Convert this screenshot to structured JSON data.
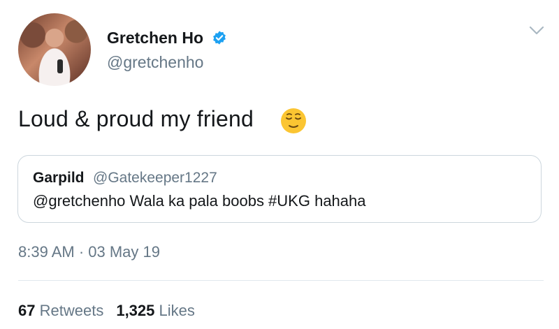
{
  "author": {
    "name": "Gretchen Ho",
    "handle": "@gretchenho",
    "verified": true,
    "avatar_icon": "profile-photo"
  },
  "tweet": {
    "text": "Loud & proud my friend",
    "emoji_icon": "relieved-face-emoji"
  },
  "quoted_tweet": {
    "name": "Garpild",
    "handle": "@Gatekeeper1227",
    "text": "@gretchenho  Wala ka pala boobs #UKG hahaha"
  },
  "timestamp": "8:39 AM · 03 May 19",
  "stats": {
    "retweets_count": "67",
    "retweets_label": "Retweets",
    "likes_count": "1,325",
    "likes_label": "Likes"
  },
  "colors": {
    "verified_blue": "#1da1f2",
    "secondary_text": "#657786",
    "primary_text": "#14171a",
    "border": "#ccd6dd"
  }
}
